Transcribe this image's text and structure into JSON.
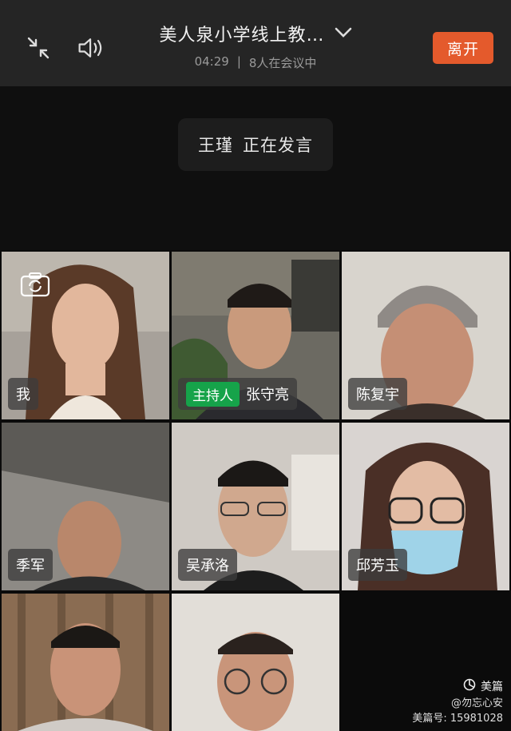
{
  "header": {
    "meeting_title": "美人泉小学线上教…",
    "elapsed_time": "04:29",
    "separator": "|",
    "participant_count": "8人在会议中",
    "leave_label": "离开"
  },
  "speaker_status": {
    "speaker_name": "王瑾",
    "status_text": "正在发言"
  },
  "participants": [
    {
      "name": "我",
      "is_self": true
    },
    {
      "name": "张守亮",
      "host_label": "主持人"
    },
    {
      "name": "陈复宇"
    },
    {
      "name": "季军"
    },
    {
      "name": "吴承洛"
    },
    {
      "name": "邱芳玉"
    },
    {
      "name": "",
      "active_speaker": true
    },
    {
      "name": ""
    }
  ],
  "watermark": {
    "brand": "美篇",
    "author": "@勿忘心安",
    "id_line": "美篇号: 15981028"
  },
  "colors": {
    "leave_button": "#e45a2c",
    "host_badge": "#16a34a",
    "active_border": "#2fae4d"
  },
  "icons": [
    "collapse-arrows-icon",
    "speaker-icon",
    "chevron-down-icon",
    "camera-switch-icon",
    "meipian-logo-icon"
  ]
}
